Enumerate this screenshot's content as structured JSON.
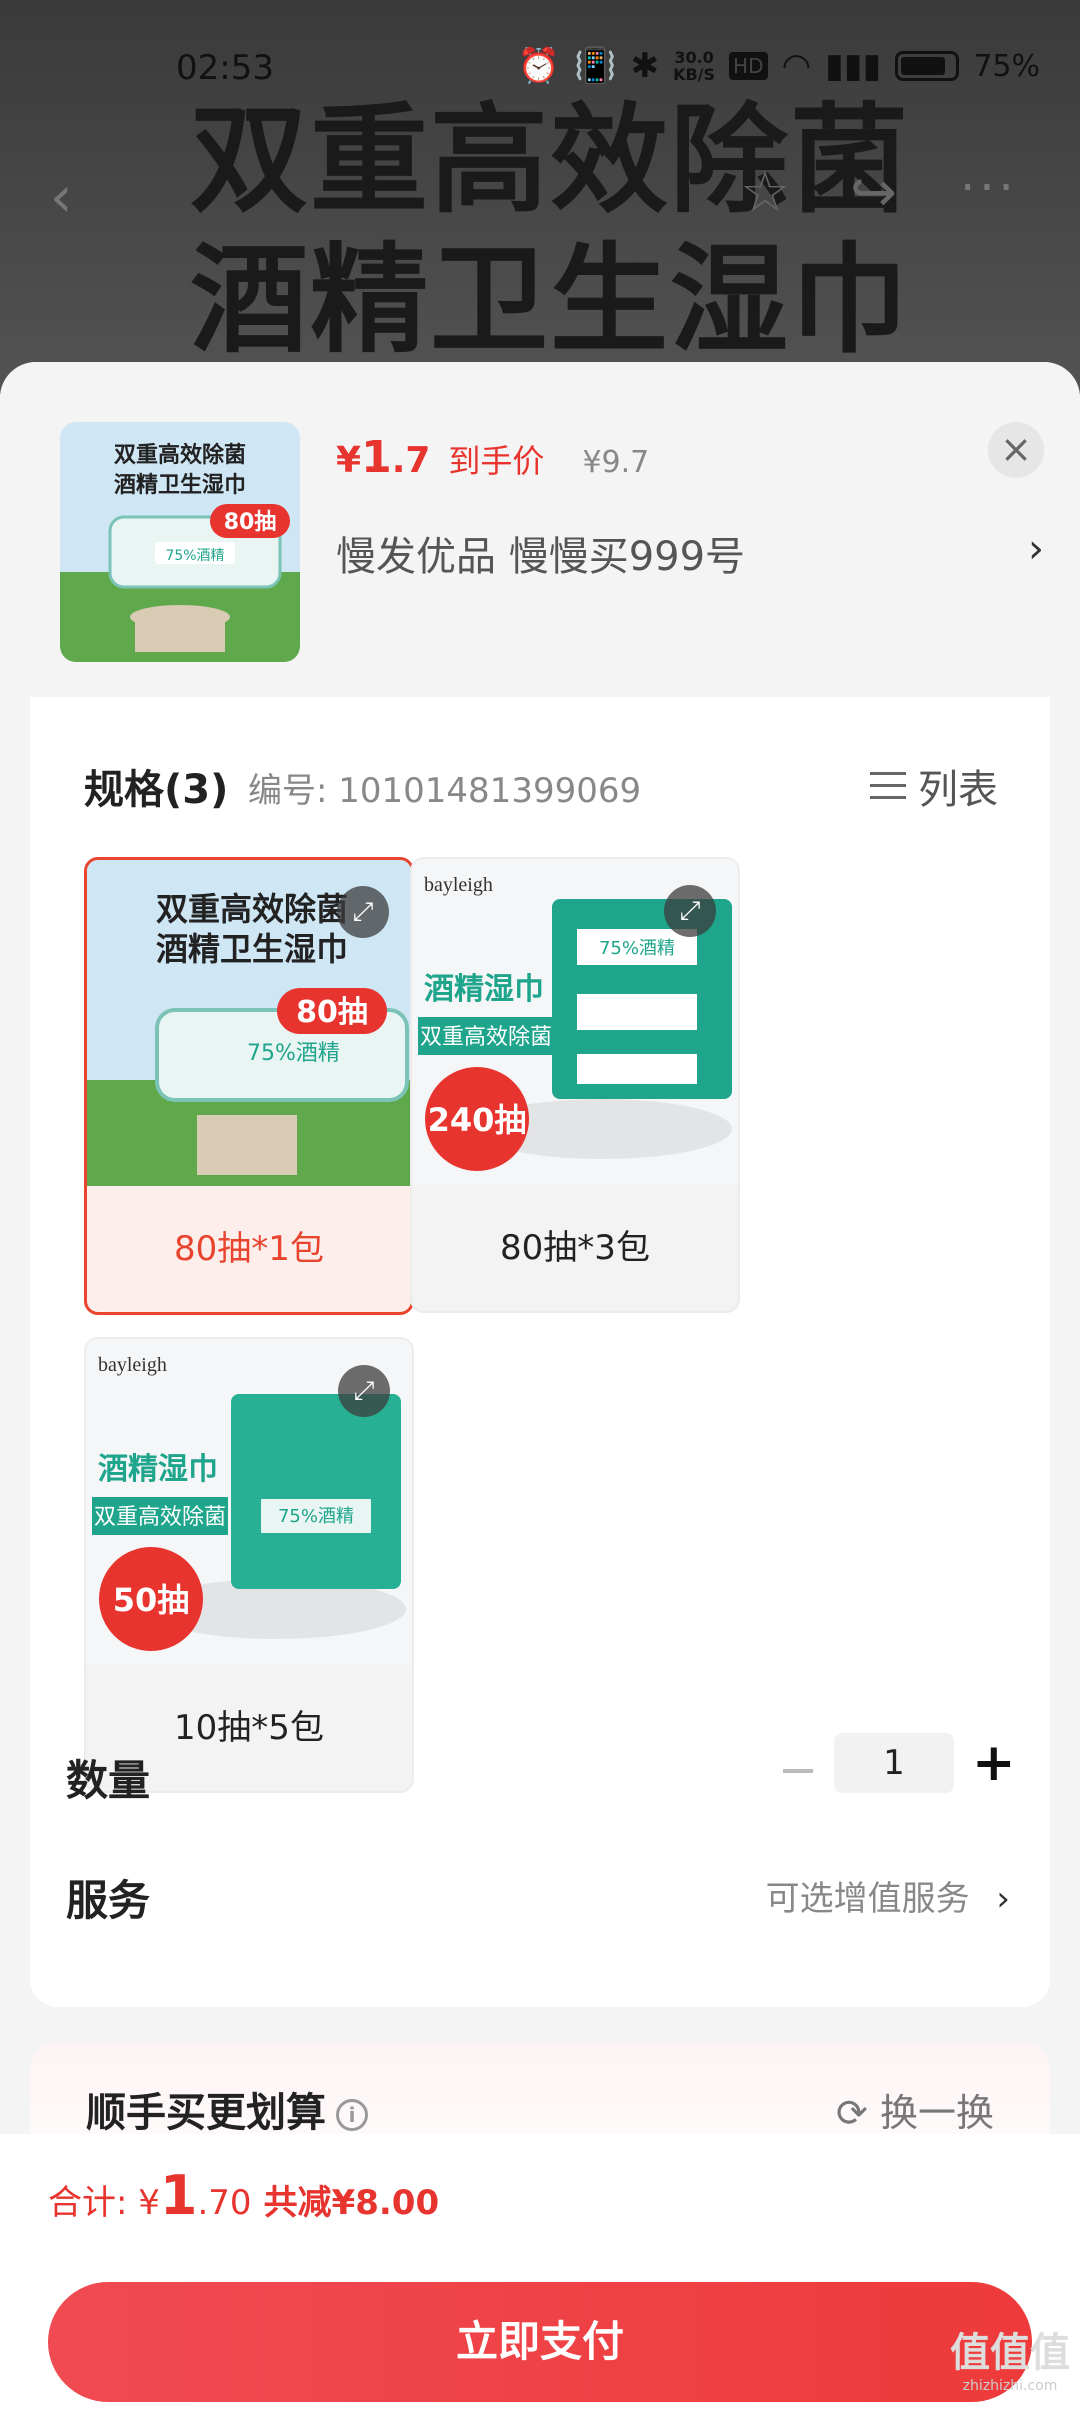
{
  "status_bar": {
    "time": "02:53",
    "net_speed": "30.0\nKB/S",
    "hd": "HD",
    "battery": "75%"
  },
  "background": {
    "banner_line1": "双重高效除菌",
    "banner_line2": "酒精卫生湿巾"
  },
  "product": {
    "thumb_title1": "双重高效除菌",
    "thumb_title2": "酒精卫生湿巾",
    "thumb_badge": "80抽",
    "price_symbol": "¥",
    "price_int": "1",
    "price_dec": ".7",
    "price_tag": "到手价",
    "orig_price": "¥9.7",
    "shop": "慢发优品  慢慢买999号"
  },
  "spec": {
    "title": "规格(3)",
    "code": "编号: 10101481399069",
    "list_label": "列表",
    "options": [
      {
        "label": "80抽*1包",
        "title1": "双重高效除菌",
        "title2": "酒精卫生湿巾",
        "badge": "80抽",
        "selected": true
      },
      {
        "label": "80抽*3包",
        "brand": "bayleigh",
        "title1": "酒精湿巾",
        "title2": "双重高效除菌",
        "badge": "240抽"
      },
      {
        "label": "10抽*5包",
        "brand": "bayleigh",
        "title1": "酒精湿巾",
        "title2": "双重高效除菌",
        "badge": "50抽"
      }
    ],
    "pack_text": "75%酒精"
  },
  "quantity": {
    "label": "数量",
    "value": "1"
  },
  "service": {
    "label": "服务",
    "value": "可选增值服务"
  },
  "upsell": {
    "title": "顺手买更划算",
    "refresh": "换一换"
  },
  "footer": {
    "total_prefix": "合计: ¥",
    "total_int": "1",
    "total_dec": ".70",
    "saving": "共减¥8.00",
    "pay_button": "立即支付"
  },
  "watermark": {
    "text": "值值值",
    "sub": "zhizhizhi.com"
  },
  "colors": {
    "accent": "#e8342e",
    "pack_teal": "#1fa58b"
  }
}
